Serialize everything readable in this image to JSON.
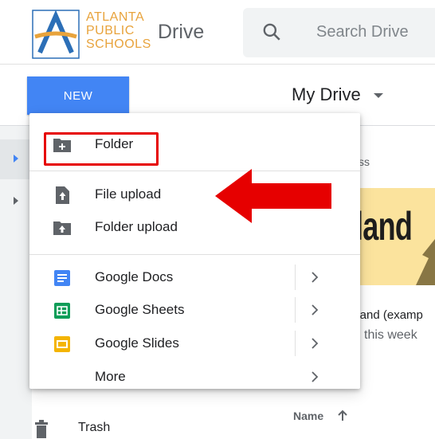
{
  "logo": {
    "lines": [
      "ATLANTA",
      "PUBLIC",
      "SCHOOLS"
    ],
    "icon": "atlanta-public-schools-logo"
  },
  "header": {
    "title": "Drive",
    "search": {
      "placeholder": "Search Drive",
      "icon": "search-icon"
    }
  },
  "new_button": {
    "label": "NEW"
  },
  "location": {
    "title": "My Drive",
    "icon": "caret-down-icon"
  },
  "menu": {
    "items": [
      {
        "label": "Folder",
        "icon": "new-folder-icon",
        "highlighted": true
      },
      {
        "label": "File upload",
        "icon": "file-upload-icon"
      },
      {
        "label": "Folder upload",
        "icon": "folder-upload-icon"
      },
      {
        "label": "Google Docs",
        "icon": "google-docs-icon",
        "submenu": true
      },
      {
        "label": "Google Sheets",
        "icon": "google-sheets-icon",
        "submenu": true
      },
      {
        "label": "Google Slides",
        "icon": "google-slides-icon",
        "submenu": true
      },
      {
        "label": "More",
        "submenu": true
      }
    ]
  },
  "background": {
    "section_fragment": "ss",
    "thumbnail_text": "land",
    "card_name": "gland (examp",
    "card_sub": "this week",
    "sort_column": "Name",
    "sidebar_bottom": {
      "label": "Trash",
      "icon": "trash-icon"
    }
  },
  "colors": {
    "accent": "#4285f4",
    "annotation": "#e60000",
    "docs": "#4285f4",
    "sheets": "#0f9d58",
    "slides": "#f4b400"
  }
}
